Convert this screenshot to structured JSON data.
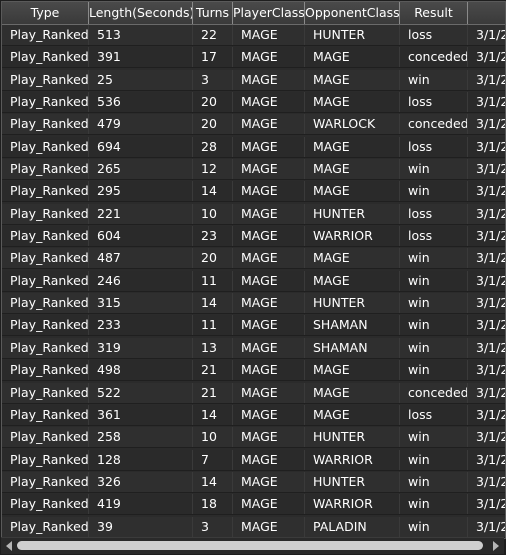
{
  "columns": [
    "Type",
    "Length(Seconds)",
    "Turns",
    "PlayerClass",
    "OpponentClass",
    "Result",
    ""
  ],
  "rows": [
    [
      "Play_Ranked",
      "513",
      "22",
      "MAGE",
      "HUNTER",
      "loss",
      "3/1/2"
    ],
    [
      "Play_Ranked",
      "391",
      "17",
      "MAGE",
      "MAGE",
      "conceded",
      "3/1/2"
    ],
    [
      "Play_Ranked",
      "25",
      "3",
      "MAGE",
      "MAGE",
      "win",
      "3/1/2"
    ],
    [
      "Play_Ranked",
      "536",
      "20",
      "MAGE",
      "MAGE",
      "loss",
      "3/1/2"
    ],
    [
      "Play_Ranked",
      "479",
      "20",
      "MAGE",
      "WARLOCK",
      "conceded",
      "3/1/2"
    ],
    [
      "Play_Ranked",
      "694",
      "28",
      "MAGE",
      "MAGE",
      "loss",
      "3/1/2"
    ],
    [
      "Play_Ranked",
      "265",
      "12",
      "MAGE",
      "MAGE",
      "win",
      "3/1/2"
    ],
    [
      "Play_Ranked",
      "295",
      "14",
      "MAGE",
      "MAGE",
      "win",
      "3/1/2"
    ],
    [
      "Play_Ranked",
      "221",
      "10",
      "MAGE",
      "HUNTER",
      "loss",
      "3/1/2"
    ],
    [
      "Play_Ranked",
      "604",
      "23",
      "MAGE",
      "WARRIOR",
      "loss",
      "3/1/2"
    ],
    [
      "Play_Ranked",
      "487",
      "20",
      "MAGE",
      "MAGE",
      "win",
      "3/1/2"
    ],
    [
      "Play_Ranked",
      "246",
      "11",
      "MAGE",
      "MAGE",
      "win",
      "3/1/2"
    ],
    [
      "Play_Ranked",
      "315",
      "14",
      "MAGE",
      "HUNTER",
      "win",
      "3/1/2"
    ],
    [
      "Play_Ranked",
      "233",
      "11",
      "MAGE",
      "SHAMAN",
      "win",
      "3/1/2"
    ],
    [
      "Play_Ranked",
      "319",
      "13",
      "MAGE",
      "SHAMAN",
      "win",
      "3/1/2"
    ],
    [
      "Play_Ranked",
      "498",
      "21",
      "MAGE",
      "MAGE",
      "win",
      "3/1/2"
    ],
    [
      "Play_Ranked",
      "522",
      "21",
      "MAGE",
      "MAGE",
      "conceded",
      "3/1/2"
    ],
    [
      "Play_Ranked",
      "361",
      "14",
      "MAGE",
      "MAGE",
      "loss",
      "3/1/2"
    ],
    [
      "Play_Ranked",
      "258",
      "10",
      "MAGE",
      "HUNTER",
      "win",
      "3/1/2"
    ],
    [
      "Play_Ranked",
      "128",
      "7",
      "MAGE",
      "WARRIOR",
      "win",
      "3/1/2"
    ],
    [
      "Play_Ranked",
      "326",
      "14",
      "MAGE",
      "HUNTER",
      "win",
      "3/1/2"
    ],
    [
      "Play_Ranked",
      "419",
      "18",
      "MAGE",
      "WARRIOR",
      "win",
      "3/1/2"
    ],
    [
      "Play_Ranked",
      "39",
      "3",
      "MAGE",
      "PALADIN",
      "win",
      "3/1/2"
    ]
  ],
  "icons": {
    "scroll_left": "arrow-left-icon",
    "scroll_right": "arrow-right-icon"
  },
  "colors": {
    "background": "#1e1e1e",
    "row": "#2f2f2f",
    "header": "#404040",
    "text": "#ffffff"
  }
}
